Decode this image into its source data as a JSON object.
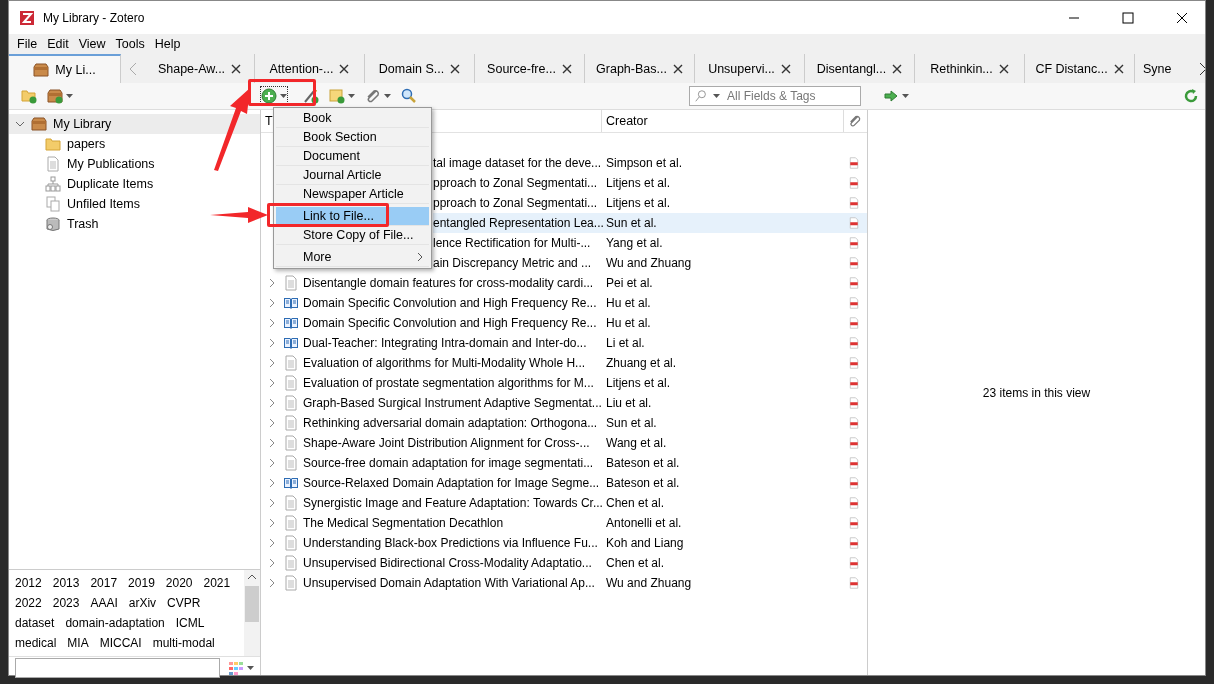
{
  "window": {
    "title": "My Library - Zotero"
  },
  "menu_bar": [
    "File",
    "Edit",
    "View",
    "Tools",
    "Help"
  ],
  "tabs": [
    {
      "label": "My Li...",
      "selected": true,
      "kind": "library"
    },
    {
      "label": "Shape-Aw...",
      "selected": false,
      "kind": "item"
    },
    {
      "label": "Attention-...",
      "selected": false,
      "kind": "item"
    },
    {
      "label": "Domain S...",
      "selected": false,
      "kind": "item"
    },
    {
      "label": "Source-fre...",
      "selected": false,
      "kind": "item"
    },
    {
      "label": "Graph-Bas...",
      "selected": false,
      "kind": "item"
    },
    {
      "label": "Unsupervi...",
      "selected": false,
      "kind": "item"
    },
    {
      "label": "Disentangl...",
      "selected": false,
      "kind": "item"
    },
    {
      "label": "Rethinkin...",
      "selected": false,
      "kind": "item"
    },
    {
      "label": "CF Distanc...",
      "selected": false,
      "kind": "item"
    },
    {
      "label": "Syne",
      "selected": false,
      "kind": "cut"
    }
  ],
  "search": {
    "placeholder": "All Fields & Tags"
  },
  "sidebar": {
    "items": [
      {
        "label": "My Library",
        "kind": "library",
        "expanded": true,
        "selected": true,
        "children": [
          {
            "label": "papers",
            "kind": "folder",
            "selected": false
          },
          {
            "label": "My Publications",
            "kind": "publications",
            "selected": false
          },
          {
            "label": "Duplicate Items",
            "kind": "duplicates",
            "selected": false
          },
          {
            "label": "Unfiled Items",
            "kind": "unfiled",
            "selected": false
          },
          {
            "label": "Trash",
            "kind": "trash",
            "selected": false
          }
        ]
      }
    ]
  },
  "tags": [
    [
      "2012",
      "2013",
      "2017",
      "2019",
      "2020",
      "2021"
    ],
    [
      "2022",
      "2023",
      "AAAI",
      "arXiv",
      "CVPR"
    ],
    [
      "dataset",
      "domain-adaptation",
      "ICML"
    ],
    [
      "medical",
      "MIA",
      "MICCAI",
      "multi-modal"
    ]
  ],
  "table": {
    "columns": [
      "T",
      "Creator"
    ],
    "rows": [
      {
        "title": "tal image dataset for the deve...",
        "creator": "Simpson et al.",
        "kind": "covered",
        "selected": false
      },
      {
        "title": "pproach to Zonal Segmentati...",
        "creator": "Litjens et al.",
        "kind": "covered",
        "selected": false
      },
      {
        "title": "pproach to Zonal Segmentati...",
        "creator": "Litjens et al.",
        "kind": "covered",
        "selected": false
      },
      {
        "title": "entangled Representation Lea...",
        "creator": "Sun et al.",
        "kind": "covered",
        "selected": true
      },
      {
        "title": "lence Rectification for Multi-...",
        "creator": "Yang et al.",
        "kind": "covered",
        "selected": false
      },
      {
        "title": "ain Discrepancy Metric and ...",
        "creator": "Wu and Zhuang",
        "kind": "covered",
        "selected": false
      },
      {
        "title": "Disentangle domain features for cross-modality cardi...",
        "creator": "Pei et al.",
        "kind": "document",
        "selected": false
      },
      {
        "title": "Domain Specific Convolution and High Frequency Re...",
        "creator": "Hu et al.",
        "kind": "book",
        "selected": false
      },
      {
        "title": "Domain Specific Convolution and High Frequency Re...",
        "creator": "Hu et al.",
        "kind": "book",
        "selected": false
      },
      {
        "title": "Dual-Teacher: Integrating Intra-domain and Inter-do...",
        "creator": "Li et al.",
        "kind": "book",
        "selected": false
      },
      {
        "title": "Evaluation of algorithms for Multi-Modality Whole H...",
        "creator": "Zhuang et al.",
        "kind": "document",
        "selected": false
      },
      {
        "title": "Evaluation of prostate segmentation algorithms for M...",
        "creator": "Litjens et al.",
        "kind": "document",
        "selected": false
      },
      {
        "title": "Graph-Based Surgical Instrument Adaptive Segmentat...",
        "creator": "Liu et al.",
        "kind": "document",
        "selected": false
      },
      {
        "title": "Rethinking adversarial domain adaptation: Orthogona...",
        "creator": "Sun et al.",
        "kind": "document",
        "selected": false
      },
      {
        "title": "Shape-Aware Joint Distribution Alignment for Cross-...",
        "creator": "Wang et al.",
        "kind": "document",
        "selected": false
      },
      {
        "title": "Source-free domain adaptation for image segmentati...",
        "creator": "Bateson et al.",
        "kind": "document",
        "selected": false
      },
      {
        "title": "Source-Relaxed Domain Adaptation for Image Segme...",
        "creator": "Bateson et al.",
        "kind": "book",
        "selected": false
      },
      {
        "title": "Synergistic Image and Feature Adaptation: Towards Cr...",
        "creator": "Chen et al.",
        "kind": "document",
        "selected": false
      },
      {
        "title": "The Medical Segmentation Decathlon",
        "creator": "Antonelli et al.",
        "kind": "document",
        "selected": false
      },
      {
        "title": "Understanding Black-box Predictions via Influence Fu...",
        "creator": "Koh and Liang",
        "kind": "document",
        "selected": false
      },
      {
        "title": "Unsupervised Bidirectional Cross-Modality Adaptatio...",
        "creator": "Chen et al.",
        "kind": "document",
        "selected": false
      },
      {
        "title": "Unsupervised Domain Adaptation With Variational Ap...",
        "creator": "Wu and Zhuang",
        "kind": "document",
        "selected": false
      }
    ]
  },
  "item_pane": {
    "message": "23 items in this view"
  },
  "new_item_menu": {
    "items": [
      {
        "label": "Book",
        "selected": false,
        "kind": "item"
      },
      {
        "label": "Book Section",
        "selected": false,
        "kind": "item"
      },
      {
        "label": "Document",
        "selected": false,
        "kind": "item"
      },
      {
        "label": "Journal Article",
        "selected": false,
        "kind": "item"
      },
      {
        "label": "Newspaper Article",
        "selected": false,
        "kind": "item"
      },
      {
        "label": "Link to File...",
        "selected": true,
        "kind": "item"
      },
      {
        "label": "Store Copy of File...",
        "selected": false,
        "kind": "item"
      },
      {
        "label": "More",
        "selected": false,
        "kind": "submenu"
      }
    ]
  }
}
